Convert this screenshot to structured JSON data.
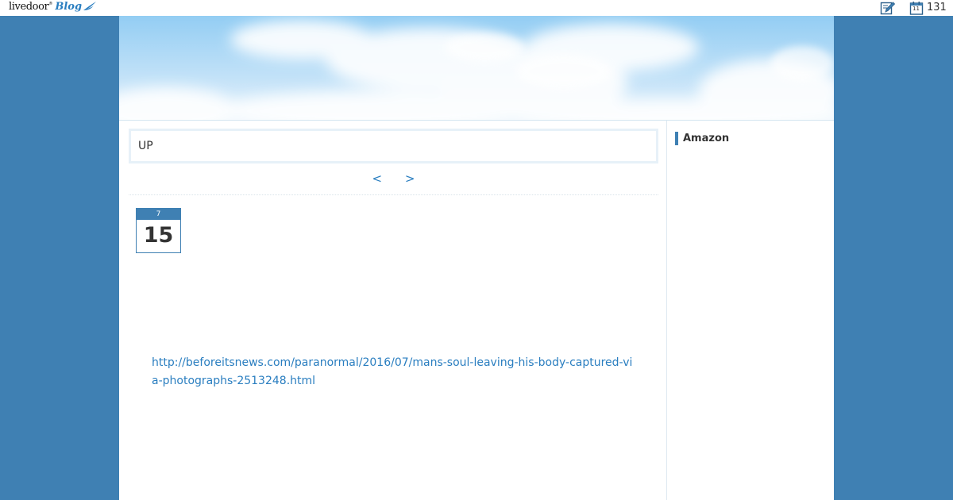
{
  "topbar": {
    "logo_main": "livedoor",
    "logo_tm": "®",
    "logo_blog": "Blog",
    "calendar_day": "11",
    "count": "131"
  },
  "main": {
    "up_text": "UP",
    "pager": {
      "prev_label": "<",
      "next_label": ">"
    },
    "entry": {
      "month": "7",
      "day": "15",
      "link": "http://beforeitsnews.com/paranormal/2016/07/mans-soul-leaving-his-body-captured-via-photographs-2513248.html"
    }
  },
  "sidebar": {
    "title": "Amazon"
  },
  "colors": {
    "background": "#3f80b3",
    "accent": "#3f80b3",
    "link": "#2a7ec0"
  },
  "icons": {
    "edit": "pencil-edit-icon",
    "calendar": "calendar-icon",
    "logo_bird": "bird-icon"
  }
}
